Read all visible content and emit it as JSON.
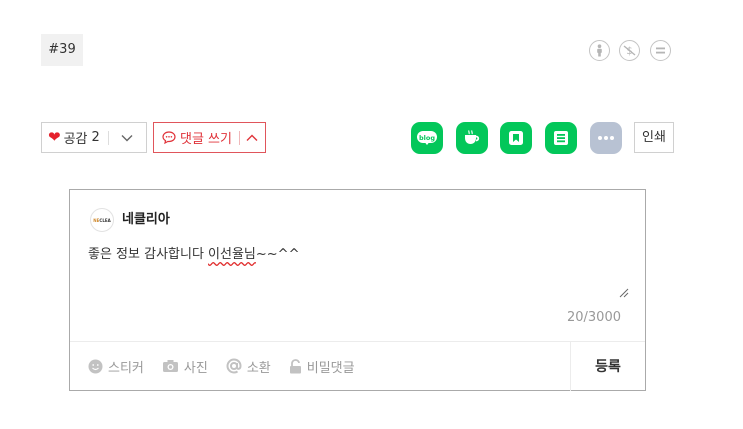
{
  "post": {
    "tag": "#39"
  },
  "reactions": {
    "like_label": "공감",
    "like_count": "2",
    "comment_label": "댓글 쓰기",
    "print_label": "인쇄",
    "share_icons": [
      "blog-icon",
      "cafe-icon",
      "keep-icon",
      "memo-icon",
      "more-icon"
    ]
  },
  "comment_form": {
    "nickname": "네클리아",
    "avatar_text_a": "NE",
    "avatar_text_b": "CLEA",
    "text_before": "좋은 정보 감사합니다 ",
    "text_spell": "이선율님",
    "text_after": "~~^^",
    "counter": "20/3000",
    "tools": {
      "sticker": "스티커",
      "photo": "사진",
      "mention": "소환",
      "secret": "비밀댓글"
    },
    "submit_label": "등록"
  },
  "colors": {
    "brand_green": "#03c75a",
    "like_red": "#e5212c",
    "comment_red": "#e0333a",
    "more_gray": "#b8c2d3"
  }
}
